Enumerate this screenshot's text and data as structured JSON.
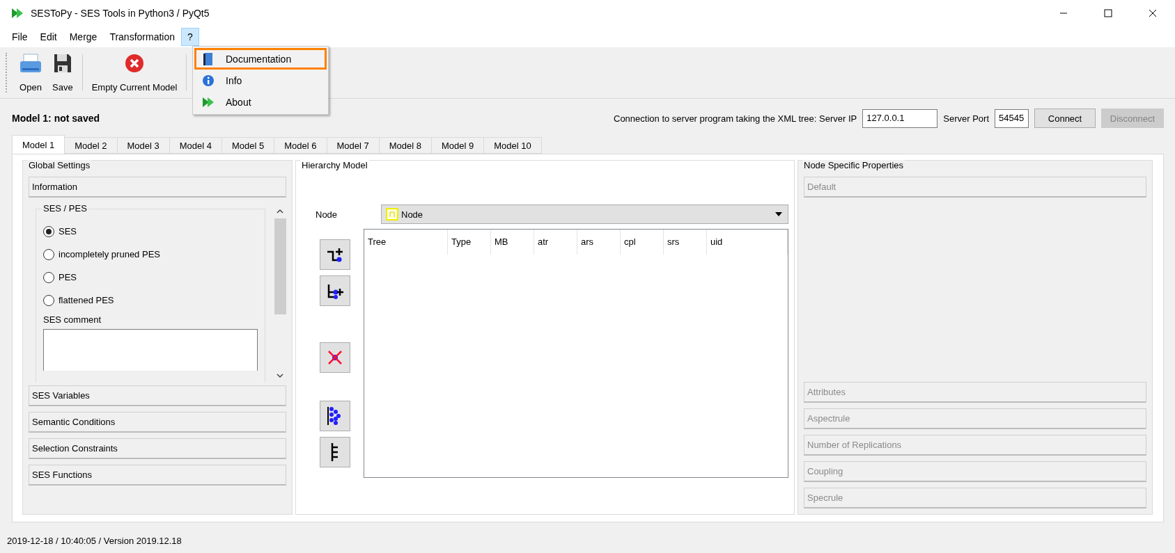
{
  "window": {
    "title": "SESToPy - SES Tools in Python3 / PyQt5"
  },
  "menu_bar": [
    {
      "label": "File",
      "open": false
    },
    {
      "label": "Edit",
      "open": false
    },
    {
      "label": "Merge",
      "open": false
    },
    {
      "label": "Transformation",
      "open": false
    },
    {
      "label": "?",
      "open": true
    }
  ],
  "open_menu": {
    "items": [
      {
        "kind": "book",
        "label": "Documentation",
        "highlighted": true
      },
      {
        "kind": "info",
        "label": "Info",
        "highlighted": false
      },
      {
        "kind": "play",
        "label": "About",
        "highlighted": false
      }
    ]
  },
  "toolbar": [
    {
      "kind": "open",
      "label": "Open"
    },
    {
      "kind": "save",
      "label": "Save"
    },
    {
      "kind": "clear",
      "label": "Empty Current Model"
    }
  ],
  "model_status": "Model 1: not saved",
  "connection": {
    "label": "Connection to server program taking the XML tree: Server IP",
    "ip": "127.0.0.1",
    "port_label": "Server Port",
    "port": "54545",
    "buttons": [
      {
        "label": "Connect",
        "disabled": false
      },
      {
        "label": "Disconnect",
        "disabled": true
      }
    ]
  },
  "tabs": [
    {
      "label": "Model 1",
      "selected": true
    },
    {
      "label": "Model 2",
      "selected": false
    },
    {
      "label": "Model 3",
      "selected": false
    },
    {
      "label": "Model 4",
      "selected": false
    },
    {
      "label": "Model 5",
      "selected": false
    },
    {
      "label": "Model 6",
      "selected": false
    },
    {
      "label": "Model 7",
      "selected": false
    },
    {
      "label": "Model 8",
      "selected": false
    },
    {
      "label": "Model 9",
      "selected": false
    },
    {
      "label": "Model 10",
      "selected": false
    }
  ],
  "global_settings": {
    "title": "Global Settings",
    "information": "Information",
    "ses_pes": {
      "title": "SES / PES",
      "options": [
        {
          "label": "SES",
          "selected": true
        },
        {
          "label": "incompletely pruned PES",
          "selected": false
        },
        {
          "label": "PES",
          "selected": false
        },
        {
          "label": "flattened PES",
          "selected": false
        }
      ],
      "comment_label": "SES comment"
    },
    "sections": [
      "SES Variables",
      "Semantic Conditions",
      "Selection Constraints",
      "SES Functions"
    ]
  },
  "hierarchy_model": {
    "title": "Hierarchy Model",
    "node_label": "Node",
    "node_value": "Node",
    "columns": [
      "Tree",
      "Type",
      "MB",
      "atr",
      "ars",
      "cpl",
      "srs",
      "uid"
    ]
  },
  "node_properties": {
    "title": "Node Specific Properties",
    "top": {
      "label": "Default",
      "disabled": true
    },
    "sections": [
      {
        "label": "Attributes",
        "disabled": true
      },
      {
        "label": "Aspectrule",
        "disabled": true
      },
      {
        "label": "Number of Replications",
        "disabled": true
      },
      {
        "label": "Coupling",
        "disabled": true
      },
      {
        "label": "Specrule",
        "disabled": true
      }
    ]
  },
  "status_bar": "2019-12-18 / 10:40:05 / Version 2019.12.18"
}
